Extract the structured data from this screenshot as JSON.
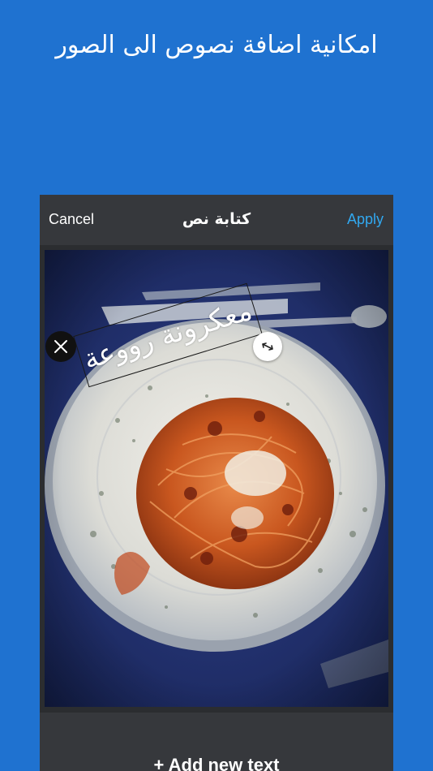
{
  "promo": {
    "headline": "امكانية اضافة نصوص الى الصور"
  },
  "navbar": {
    "cancel_label": "Cancel",
    "title": "كتابة نص",
    "apply_label": "Apply"
  },
  "canvas": {
    "overlay_text": "معكرونة رووعة",
    "delete_icon": "close-icon",
    "resize_icon": "resize-arrows-icon"
  },
  "bottom_bar": {
    "add_text_label": "+ Add new text"
  },
  "colors": {
    "background": "#1f72d0",
    "accent": "#31a8f0",
    "toolbar": "#36383c"
  }
}
